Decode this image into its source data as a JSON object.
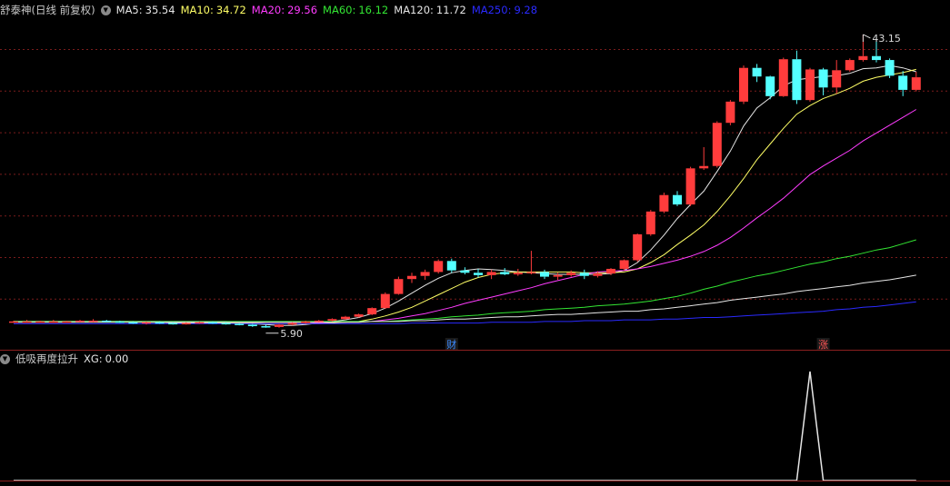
{
  "main_panel": {
    "title": "舒泰神(日线 前复权)",
    "toggle_icon": "chevron-down-icon",
    "ma_items": [
      {
        "key": "MA5",
        "label": "MA5:",
        "value": "35.54",
        "color": "#e6e6e6"
      },
      {
        "key": "MA10",
        "label": "MA10:",
        "value": "34.72",
        "color": "#ffff66"
      },
      {
        "key": "MA20",
        "label": "MA20:",
        "value": "29.56",
        "color": "#ff3cff"
      },
      {
        "key": "MA60",
        "label": "MA60:",
        "value": "16.12",
        "color": "#33e633"
      },
      {
        "key": "MA120",
        "label": "MA120:",
        "value": "11.72",
        "color": "#e6e6e6"
      },
      {
        "key": "MA250",
        "label": "MA250:",
        "value": "9.28",
        "color": "#2a2aff"
      }
    ],
    "high_label": "43.15",
    "low_label": "5.90",
    "markers": [
      {
        "text": "财",
        "bar": 33,
        "color": "#3d8bff"
      },
      {
        "text": "涨",
        "bar": 61,
        "color": "#ff5555"
      }
    ]
  },
  "indicator_panel": {
    "title": "低吸再度拉升",
    "toggle_icon": "chevron-down-icon",
    "label": "XG:",
    "value": "0.00",
    "color": "#e6e6e6"
  },
  "colors": {
    "up": "#ff3c3c",
    "down": "#54ffff",
    "grid": "#7a1c1c",
    "panel_border": "#8b2020"
  },
  "chart_data": {
    "type": "candlestick",
    "price_range": [
      4.5,
      45.0
    ],
    "candles": [
      [
        6.6,
        6.7,
        6.5,
        6.6
      ],
      [
        6.6,
        6.8,
        6.5,
        6.6
      ],
      [
        6.6,
        6.7,
        6.5,
        6.6
      ],
      [
        6.6,
        6.8,
        6.5,
        6.6
      ],
      [
        6.6,
        6.7,
        6.5,
        6.6
      ],
      [
        6.6,
        6.8,
        6.5,
        6.7
      ],
      [
        6.7,
        6.9,
        6.5,
        6.7
      ],
      [
        6.7,
        6.8,
        6.5,
        6.6
      ],
      [
        6.6,
        6.7,
        6.4,
        6.5
      ],
      [
        6.5,
        6.6,
        6.3,
        6.4
      ],
      [
        6.4,
        6.6,
        6.2,
        6.5
      ],
      [
        6.5,
        6.6,
        6.3,
        6.4
      ],
      [
        6.4,
        6.5,
        6.2,
        6.3
      ],
      [
        6.3,
        6.5,
        6.2,
        6.4
      ],
      [
        6.4,
        6.6,
        6.3,
        6.5
      ],
      [
        6.5,
        6.6,
        6.3,
        6.4
      ],
      [
        6.4,
        6.5,
        6.2,
        6.3
      ],
      [
        6.3,
        6.4,
        6.1,
        6.2
      ],
      [
        6.2,
        6.3,
        5.9,
        6.0
      ],
      [
        6.0,
        6.2,
        5.8,
        5.9
      ],
      [
        5.9,
        6.3,
        5.8,
        6.2
      ],
      [
        6.2,
        6.5,
        6.1,
        6.4
      ],
      [
        6.4,
        6.7,
        6.3,
        6.6
      ],
      [
        6.6,
        6.8,
        6.5,
        6.7
      ],
      [
        6.7,
        7.0,
        6.6,
        6.9
      ],
      [
        6.9,
        7.3,
        6.8,
        7.2
      ],
      [
        7.2,
        7.6,
        7.1,
        7.5
      ],
      [
        7.5,
        8.4,
        7.4,
        8.3
      ],
      [
        8.3,
        10.3,
        8.2,
        10.1
      ],
      [
        10.1,
        12.3,
        10.0,
        12.0
      ],
      [
        12.0,
        12.8,
        11.5,
        12.4
      ],
      [
        12.4,
        13.2,
        11.9,
        12.9
      ],
      [
        12.9,
        14.5,
        12.7,
        14.3
      ],
      [
        14.3,
        14.6,
        12.8,
        13.1
      ],
      [
        13.1,
        13.5,
        12.6,
        12.8
      ],
      [
        12.8,
        13.3,
        12.2,
        12.5
      ],
      [
        12.5,
        13.2,
        12.0,
        12.9
      ],
      [
        12.9,
        13.4,
        12.5,
        12.6
      ],
      [
        12.6,
        13.3,
        12.4,
        12.8
      ],
      [
        12.8,
        15.6,
        12.6,
        12.9
      ],
      [
        12.9,
        13.2,
        12.0,
        12.3
      ],
      [
        12.3,
        12.8,
        11.9,
        12.5
      ],
      [
        12.5,
        13.1,
        12.3,
        12.8
      ],
      [
        12.8,
        13.2,
        12.0,
        12.4
      ],
      [
        12.4,
        13.0,
        12.2,
        12.7
      ],
      [
        12.7,
        13.4,
        12.5,
        13.3
      ],
      [
        13.3,
        14.5,
        13.1,
        14.4
      ],
      [
        14.4,
        17.8,
        14.2,
        17.7
      ],
      [
        17.7,
        20.8,
        17.5,
        20.6
      ],
      [
        20.6,
        23.0,
        20.4,
        22.7
      ],
      [
        22.7,
        23.2,
        21.3,
        21.5
      ],
      [
        21.5,
        26.3,
        21.3,
        26.1
      ],
      [
        26.1,
        28.8,
        25.9,
        26.4
      ],
      [
        26.4,
        32.1,
        26.2,
        31.9
      ],
      [
        31.9,
        34.8,
        31.6,
        34.6
      ],
      [
        34.6,
        39.2,
        34.3,
        38.9
      ],
      [
        38.9,
        39.4,
        37.1,
        37.8
      ],
      [
        37.8,
        37.9,
        34.9,
        35.3
      ],
      [
        35.3,
        40.2,
        35.2,
        40.0
      ],
      [
        40.0,
        41.1,
        34.3,
        34.8
      ],
      [
        34.8,
        38.9,
        34.6,
        38.7
      ],
      [
        38.7,
        38.9,
        35.4,
        36.4
      ],
      [
        36.4,
        39.9,
        35.6,
        38.6
      ],
      [
        38.6,
        40.1,
        38.4,
        39.9
      ],
      [
        39.9,
        43.15,
        39.7,
        40.4
      ],
      [
        40.4,
        43.15,
        39.6,
        39.9
      ],
      [
        39.9,
        40.1,
        37.6,
        37.9
      ],
      [
        37.9,
        38.5,
        35.3,
        36.1
      ],
      [
        36.1,
        38.4,
        35.9,
        37.7
      ]
    ],
    "moving_averages": {
      "MA5": [
        6.6,
        6.6,
        6.6,
        6.6,
        6.6,
        6.6,
        6.6,
        6.6,
        6.6,
        6.6,
        6.5,
        6.5,
        6.4,
        6.4,
        6.4,
        6.4,
        6.4,
        6.3,
        6.3,
        6.2,
        6.1,
        6.1,
        6.2,
        6.4,
        6.6,
        6.8,
        7.1,
        7.6,
        8.3,
        9.2,
        10.2,
        11.2,
        12.1,
        12.8,
        13.1,
        13.3,
        13.2,
        13.1,
        12.9,
        12.8,
        12.7,
        12.6,
        12.6,
        12.6,
        12.6,
        12.7,
        13.1,
        14.1,
        15.7,
        17.6,
        19.7,
        21.5,
        23.2,
        25.7,
        28.3,
        31.5,
        33.8,
        35.1,
        36.6,
        37.4,
        37.6,
        37.8,
        37.9,
        38.2,
        38.8,
        38.9,
        39.2,
        38.9,
        38.4
      ],
      "MA10": [
        6.6,
        6.6,
        6.6,
        6.6,
        6.6,
        6.6,
        6.6,
        6.6,
        6.6,
        6.6,
        6.6,
        6.6,
        6.5,
        6.5,
        6.5,
        6.5,
        6.4,
        6.4,
        6.4,
        6.3,
        6.3,
        6.3,
        6.3,
        6.3,
        6.4,
        6.5,
        6.6,
        6.9,
        7.3,
        7.8,
        8.4,
        9.2,
        10.0,
        10.8,
        11.6,
        12.2,
        12.6,
        12.8,
        12.9,
        12.9,
        12.9,
        12.9,
        12.9,
        12.8,
        12.8,
        12.8,
        12.9,
        13.3,
        14.1,
        15.1,
        16.4,
        17.6,
        18.9,
        20.6,
        22.6,
        24.8,
        27.2,
        29.2,
        31.2,
        33.0,
        34.1,
        35.0,
        35.6,
        36.3,
        37.2,
        37.7,
        38.0,
        38.3,
        38.7
      ],
      "MA20": [
        6.6,
        6.6,
        6.6,
        6.6,
        6.6,
        6.6,
        6.6,
        6.6,
        6.6,
        6.6,
        6.6,
        6.6,
        6.6,
        6.6,
        6.6,
        6.6,
        6.6,
        6.5,
        6.5,
        6.5,
        6.5,
        6.5,
        6.5,
        6.4,
        6.5,
        6.5,
        6.5,
        6.6,
        6.8,
        7.0,
        7.3,
        7.6,
        8.0,
        8.4,
        8.9,
        9.3,
        9.7,
        10.1,
        10.5,
        10.9,
        11.4,
        11.8,
        12.2,
        12.6,
        12.9,
        13.0,
        13.1,
        13.3,
        13.6,
        14.0,
        14.4,
        14.9,
        15.5,
        16.3,
        17.3,
        18.5,
        19.8,
        21.0,
        22.3,
        23.8,
        25.3,
        26.4,
        27.4,
        28.4,
        29.6,
        30.6,
        31.6,
        32.6,
        33.6
      ],
      "MA60": [
        6.6,
        6.6,
        6.6,
        6.6,
        6.6,
        6.6,
        6.6,
        6.6,
        6.6,
        6.6,
        6.6,
        6.6,
        6.6,
        6.6,
        6.6,
        6.6,
        6.6,
        6.6,
        6.6,
        6.6,
        6.6,
        6.6,
        6.6,
        6.6,
        6.6,
        6.6,
        6.6,
        6.6,
        6.6,
        6.7,
        6.8,
        6.9,
        7.0,
        7.2,
        7.3,
        7.4,
        7.6,
        7.7,
        7.8,
        7.9,
        8.1,
        8.2,
        8.3,
        8.4,
        8.6,
        8.7,
        8.8,
        9.0,
        9.2,
        9.5,
        9.8,
        10.2,
        10.7,
        11.1,
        11.6,
        12.0,
        12.4,
        12.7,
        13.1,
        13.5,
        13.9,
        14.2,
        14.6,
        14.9,
        15.3,
        15.7,
        16.0,
        16.5,
        17.0
      ],
      "MA120": [
        6.5,
        6.5,
        6.5,
        6.5,
        6.5,
        6.5,
        6.5,
        6.5,
        6.5,
        6.5,
        6.5,
        6.5,
        6.5,
        6.5,
        6.5,
        6.5,
        6.5,
        6.5,
        6.5,
        6.5,
        6.5,
        6.5,
        6.5,
        6.5,
        6.5,
        6.5,
        6.5,
        6.6,
        6.6,
        6.6,
        6.7,
        6.7,
        6.8,
        6.9,
        6.9,
        7.0,
        7.1,
        7.2,
        7.2,
        7.3,
        7.4,
        7.5,
        7.5,
        7.6,
        7.7,
        7.8,
        7.9,
        7.9,
        8.1,
        8.2,
        8.4,
        8.6,
        8.8,
        9.0,
        9.3,
        9.5,
        9.7,
        9.9,
        10.1,
        10.4,
        10.6,
        10.8,
        11.0,
        11.2,
        11.5,
        11.7,
        11.9,
        12.2,
        12.5
      ],
      "MA250": [
        6.3,
        6.3,
        6.3,
        6.3,
        6.3,
        6.3,
        6.3,
        6.3,
        6.3,
        6.3,
        6.3,
        6.3,
        6.3,
        6.3,
        6.3,
        6.3,
        6.3,
        6.3,
        6.3,
        6.3,
        6.3,
        6.3,
        6.3,
        6.3,
        6.3,
        6.3,
        6.3,
        6.3,
        6.3,
        6.3,
        6.4,
        6.4,
        6.4,
        6.4,
        6.4,
        6.4,
        6.5,
        6.5,
        6.5,
        6.5,
        6.6,
        6.6,
        6.6,
        6.7,
        6.7,
        6.7,
        6.8,
        6.8,
        6.8,
        6.9,
        6.9,
        7.0,
        7.1,
        7.1,
        7.2,
        7.3,
        7.4,
        7.5,
        7.6,
        7.7,
        7.8,
        7.9,
        8.1,
        8.2,
        8.4,
        8.5,
        8.7,
        8.9,
        9.1
      ]
    },
    "indicator": {
      "name": "XG",
      "values": [
        0,
        0,
        0,
        0,
        0,
        0,
        0,
        0,
        0,
        0,
        0,
        0,
        0,
        0,
        0,
        0,
        0,
        0,
        0,
        0,
        0,
        0,
        0,
        0,
        0,
        0,
        0,
        0,
        0,
        0,
        0,
        0,
        0,
        0,
        0,
        0,
        0,
        0,
        0,
        0,
        0,
        0,
        0,
        0,
        0,
        0,
        0,
        0,
        0,
        0,
        0,
        0,
        0,
        0,
        0,
        0,
        0,
        0,
        0,
        0,
        1,
        0,
        0,
        0,
        0,
        0,
        0,
        0,
        0
      ],
      "range": [
        0,
        1
      ]
    }
  }
}
